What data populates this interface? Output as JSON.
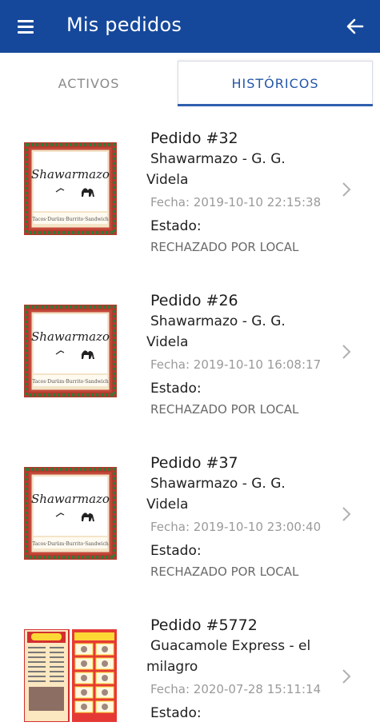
{
  "header": {
    "title": "Mis pedidos",
    "bg_color": "#15489b",
    "menu_icon": "hamburger-menu-icon",
    "back_icon": "arrow-left-icon"
  },
  "tabs": [
    {
      "label": "ACTIVOS",
      "active": false
    },
    {
      "label": "HISTÓRICOS",
      "active": true
    }
  ],
  "orders": [
    {
      "number": "Pedido #32",
      "store_line1": "Shawarmazo - G. G.",
      "store_line2": "Videla",
      "date": "Fecha: 2019-10-10 22:15:38",
      "status_label": "Estado:",
      "status": "RECHAZADO POR LOCAL",
      "thumb": "shawarmazo-logo"
    },
    {
      "number": "Pedido #26",
      "store_line1": "Shawarmazo - G. G.",
      "store_line2": "Videla",
      "date": "Fecha: 2019-10-10 16:08:17",
      "status_label": "Estado:",
      "status": "RECHAZADO POR LOCAL",
      "thumb": "shawarmazo-logo"
    },
    {
      "number": "Pedido #37",
      "store_line1": "Shawarmazo - G. G.",
      "store_line2": "Videla",
      "date": "Fecha: 2019-10-10 23:00:40",
      "status_label": "Estado:",
      "status": "RECHAZADO POR LOCAL",
      "thumb": "shawarmazo-logo"
    },
    {
      "number": "Pedido #5772",
      "store_line1": "Guacamole Express - el",
      "store_line2": "milagro",
      "date": "Fecha: 2020-07-28 15:11:14",
      "status_label": "Estado:",
      "status": "",
      "thumb": "guacamole-menu"
    }
  ],
  "brand": {
    "shawarmazo_text": "Shawarmazo",
    "shawarmazo_sub": "Tacos · Durüm · Burrito · Sandwich"
  }
}
